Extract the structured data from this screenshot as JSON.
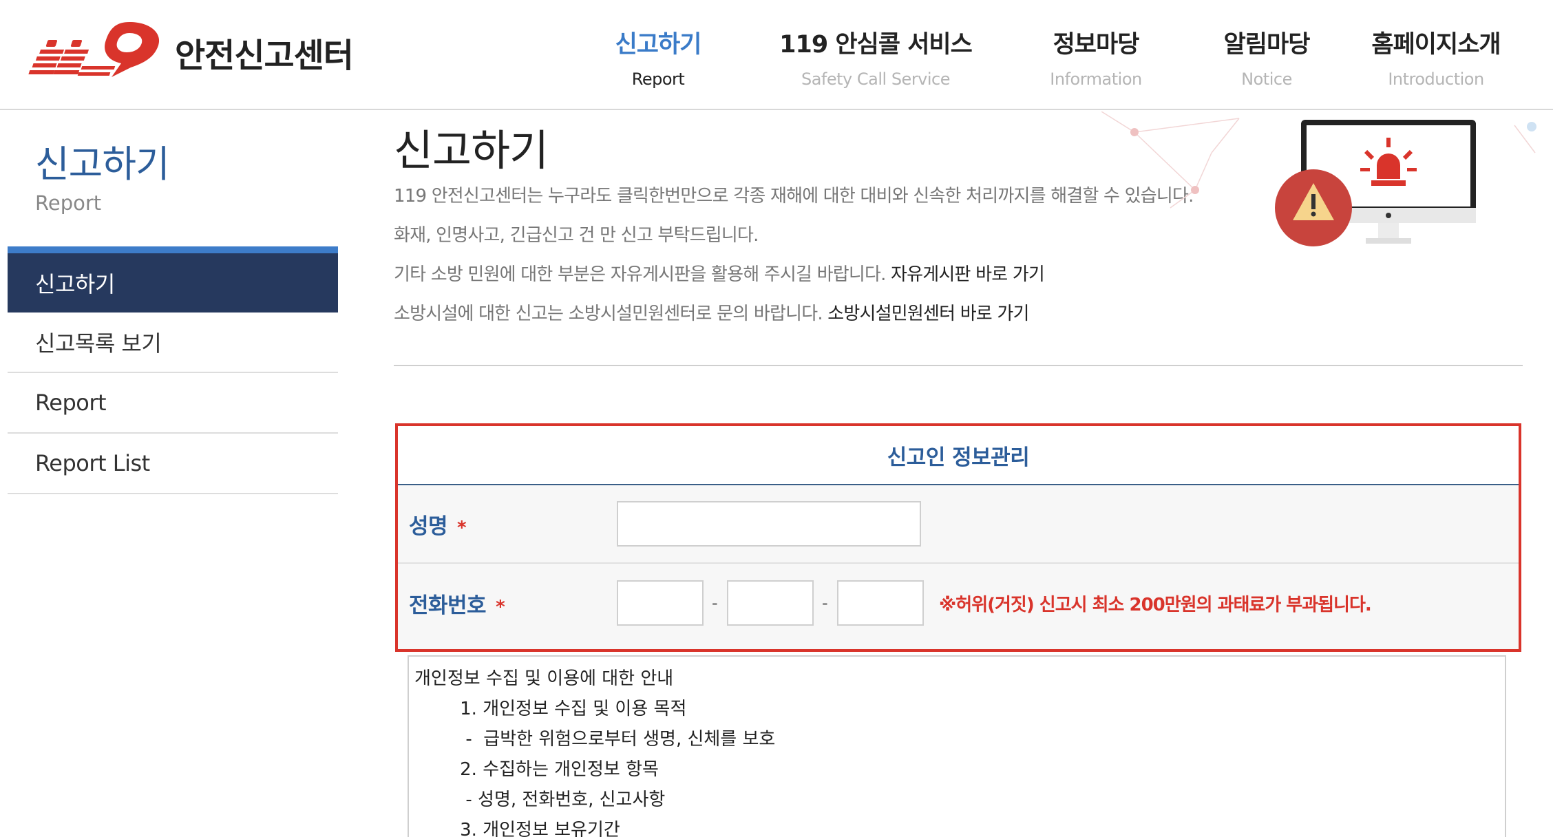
{
  "header": {
    "logo_text": "안전신고센터",
    "logo_mark": "119",
    "nav": [
      {
        "ko": "신고하기",
        "en": "Report"
      },
      {
        "ko": "119 안심콜 서비스",
        "en": "Safety Call Service"
      },
      {
        "ko": "정보마당",
        "en": "Information"
      },
      {
        "ko": "알림마당",
        "en": "Notice"
      },
      {
        "ko": "홈페이지소개",
        "en": "Introduction"
      }
    ]
  },
  "sidebar": {
    "title": "신고하기",
    "subtitle": "Report",
    "items": [
      {
        "label": "신고하기"
      },
      {
        "label": "신고목록 보기"
      },
      {
        "label": "Report"
      },
      {
        "label": "Report List"
      }
    ]
  },
  "main": {
    "title": "신고하기",
    "desc1": "119 안전신고센터는 누구라도 클릭한번만으로 각종 재해에 대한 대비와 신속한 처리까지를 해결할 수 있습니다.",
    "desc2": "화재, 인명사고, 긴급신고 건 만 신고 부탁드립니다.",
    "desc3": "기타 소방 민원에 대한 부분은 자유게시판을 활용해 주시길 바랍니다.",
    "desc3_link": "자유게시판 바로 가기",
    "desc4": "소방시설에 대한 신고는 소방시설민원센터로 문의 바랍니다.",
    "desc4_link": "소방시설민원센터 바로 가기"
  },
  "form": {
    "title": "신고인 정보관리",
    "name_label": "성명",
    "phone_label": "전화번호",
    "required_mark": "*",
    "name_value": "",
    "phone1_value": "",
    "phone2_value": "",
    "phone3_value": "",
    "dash": "-",
    "warning": "※허위(거짓) 신고시 최소 200만원의 과태료가 부과됩니다."
  },
  "privacy": {
    "lines": [
      "개인정보 수집 및 이용에 대한 안내",
      "        1. 개인정보 수집 및 이용 목적",
      "         -  급박한 위험으로부터 생명, 신체를 보호",
      "        2. 수집하는 개인정보 항목",
      "         - 성명, 전화번호, 신고사항",
      "        3. 개인정보 보유기간"
    ]
  },
  "colors": {
    "accent_blue": "#2c5d9a",
    "nav_active": "#3a7bc8",
    "sidebar_active_bg": "#26395e",
    "warning_red": "#d9342b",
    "logo_red": "#d9342b"
  }
}
